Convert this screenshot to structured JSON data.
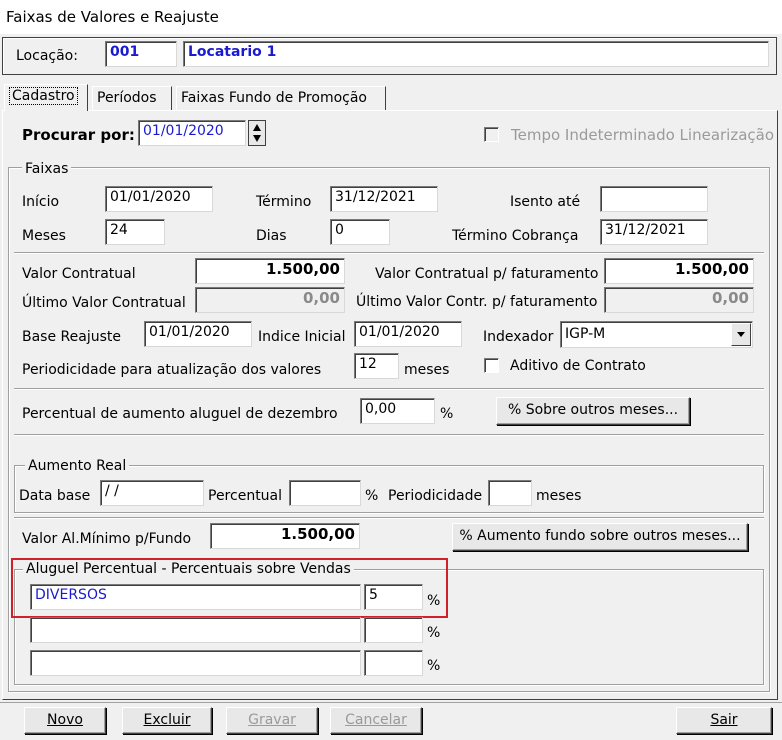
{
  "window": {
    "title": "Faixas de Valores e Reajuste"
  },
  "header": {
    "locacao_label": "Locação:",
    "locacao_code": "001",
    "locacao_name": "Locatario 1"
  },
  "tabs": [
    {
      "label": "Cadastro",
      "active": true
    },
    {
      "label": "Períodos",
      "active": false
    },
    {
      "label": "Faixas Fundo de Promoção",
      "active": false
    }
  ],
  "search": {
    "label": "Procurar por:",
    "value": "01/01/2020",
    "tempo_indeterminado_label": "Tempo Indeterminado Linearização"
  },
  "faixas": {
    "title": "Faixas",
    "inicio_label": "Início",
    "inicio_value": "01/01/2020",
    "termino_label": "Término",
    "termino_value": "31/12/2021",
    "isento_label": "Isento até",
    "isento_value": "",
    "meses_label": "Meses",
    "meses_value": "24",
    "dias_label": "Dias",
    "dias_value": "0",
    "termino_cobranca_label": "Término Cobrança",
    "termino_cobranca_value": "31/12/2021",
    "valor_contratual_label": "Valor Contratual",
    "valor_contratual_value": "1.500,00",
    "valor_contratual_fat_label": "Valor Contratual p/ faturamento",
    "valor_contratual_fat_value": "1.500,00",
    "ultimo_valor_label": "Último Valor Contratual",
    "ultimo_valor_value": "0,00",
    "ultimo_valor_fat_label": "Último Valor Contr. p/ faturamento",
    "ultimo_valor_fat_value": "0,00",
    "base_reajuste_label": "Base Reajuste",
    "base_reajuste_value": "01/01/2020",
    "indice_inicial_label": "Indice Inicial",
    "indice_inicial_value": "01/01/2020",
    "indexador_label": "Indexador",
    "indexador_value": "IGP-M",
    "periodicidade_label": "Periodicidade para atualização dos valores",
    "periodicidade_value": "12",
    "periodicidade_unit": "meses",
    "aditivo_label": "Aditivo de Contrato",
    "percentual_dez_label": "Percentual de aumento aluguel de dezembro",
    "percentual_dez_value": "0,00",
    "percent_sign": "%",
    "sobre_outros_meses_button": "% Sobre outros meses..."
  },
  "aumento_real": {
    "title": "Aumento Real",
    "data_base_label": "Data base",
    "data_base_value": " / /",
    "percentual_label": "Percentual",
    "percentual_value": "",
    "percent_sign": "%",
    "periodicidade_label": "Periodicidade",
    "periodicidade_value": "",
    "meses_label": "meses"
  },
  "fundo": {
    "valor_minimo_label": "Valor Al.Mínimo p/Fundo",
    "valor_minimo_value": "1.500,00",
    "aumento_fundo_button": "% Aumento fundo sobre outros meses..."
  },
  "aluguel_percentual": {
    "title": "Aluguel Percentual - Percentuais sobre Vendas",
    "rows": [
      {
        "description": "DIVERSOS",
        "percent": "5",
        "sign": "%"
      },
      {
        "description": "",
        "percent": "",
        "sign": "%"
      },
      {
        "description": "",
        "percent": "",
        "sign": "%"
      }
    ],
    "highlight_color": "#d0202a"
  },
  "footer": {
    "novo": "Novo",
    "excluir": "Excluir",
    "gravar": "Gravar",
    "cancelar": "Cancelar",
    "sair": "Sair"
  },
  "colors": {
    "accent_text": "#1a1ad0",
    "window_bg": "#f0f0f0"
  }
}
